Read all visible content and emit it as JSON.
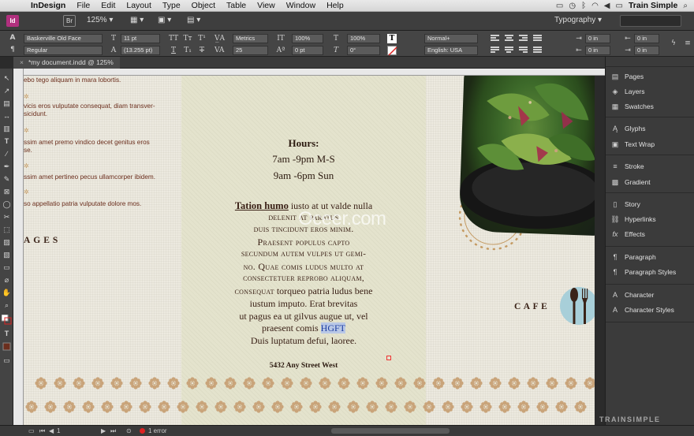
{
  "menubar": {
    "app_name": "InDesign",
    "items": [
      "File",
      "Edit",
      "Layout",
      "Type",
      "Object",
      "Table",
      "View",
      "Window",
      "Help"
    ],
    "right_app": "Train Simple"
  },
  "appbar": {
    "zoom": "125%",
    "workspace": "Typography",
    "search_placeholder": ""
  },
  "control": {
    "font_family": "Baskerville Old Face",
    "font_style": "Regular",
    "font_size": "11 pt",
    "leading": "(13.255 pt)",
    "kerning": "Metrics",
    "tracking": "25",
    "vscale": "100%",
    "hscale": "100%",
    "baseline": "0 pt",
    "skew": "0°",
    "char_style": "Normal+",
    "language": "English: USA",
    "indent_left": "0 in",
    "indent_right": "0 in",
    "space_before": "0 in",
    "space_after": "0 in"
  },
  "document": {
    "tab_title": "*my document.indd @ 125%"
  },
  "canvas": {
    "left_texts": [
      "ebo tego aliquam in mara lobortis.",
      "vicis eros vulputate consequat, diam transver-",
      "sicidunt.",
      "ssim amet premo vindico decet genitus eros",
      "se.",
      "ssim amet pertineo pecus ullamcorper ibidem.",
      "so appellatio patria vulputate dolore mos."
    ],
    "pages_heading": "AGES",
    "hours_title": "Hours:",
    "hours_line1": "7am -9pm M-S",
    "hours_line2": "9am -6pm Sun",
    "body_lines": [
      {
        "pre": "Tation humo",
        "rest": " iusto at ut valde nulla"
      },
      "delenit at paratus",
      "duis tincidunt eros minim.",
      "Praesent populus capto",
      "secundum autem vulpes ut gemi-",
      "no. Quae comis ludus multo at",
      "consectetuer reprobo aliquam,",
      {
        "pre": "consequat",
        "rest": " torqueo patria ludus bene"
      },
      "iustum imputo. Erat brevitas",
      "ut pagus ea ut gilvus augue ut, vel",
      {
        "pre": "praesent comis ",
        "sel": "HGFT"
      },
      "Duis luptatum defui, laoree."
    ],
    "address": "5432 Any Street West",
    "cafe": "CAFE",
    "watermark": "Oceer.com"
  },
  "panels": [
    {
      "icon": "pages-icon",
      "label": "Pages"
    },
    {
      "icon": "layers-icon",
      "label": "Layers"
    },
    {
      "icon": "swatches-icon",
      "label": "Swatches"
    },
    {
      "icon": "glyphs-icon",
      "label": "Glyphs"
    },
    {
      "icon": "text-wrap-icon",
      "label": "Text Wrap"
    },
    {
      "icon": "stroke-icon",
      "label": "Stroke"
    },
    {
      "icon": "gradient-icon",
      "label": "Gradient"
    },
    {
      "icon": "story-icon",
      "label": "Story"
    },
    {
      "icon": "hyperlinks-icon",
      "label": "Hyperlinks"
    },
    {
      "icon": "effects-icon",
      "label": "Effects"
    },
    {
      "icon": "paragraph-icon",
      "label": "Paragraph"
    },
    {
      "icon": "paragraph-styles-icon",
      "label": "Paragraph Styles"
    },
    {
      "icon": "character-icon",
      "label": "Character"
    },
    {
      "icon": "character-styles-icon",
      "label": "Character Styles"
    }
  ],
  "status": {
    "page": "1",
    "errors": "1 error"
  },
  "branding": {
    "trainsimple": "TRAINSIMPLE"
  }
}
